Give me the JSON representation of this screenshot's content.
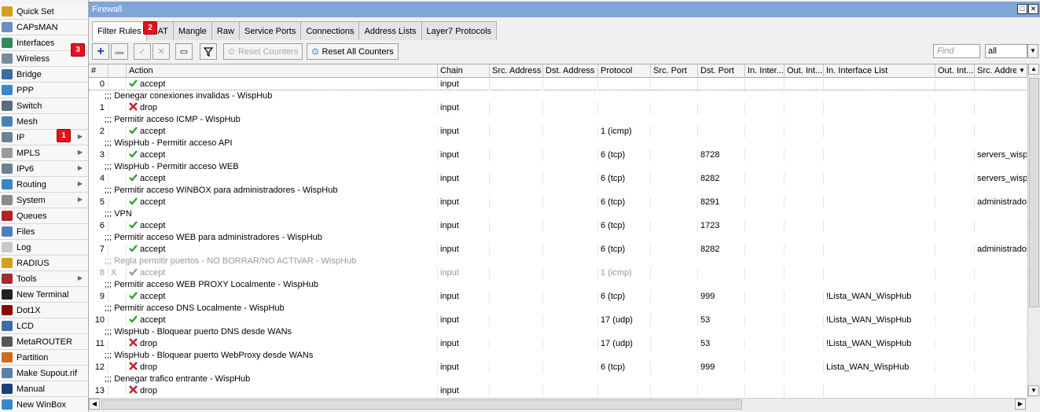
{
  "sidebar": {
    "items": [
      {
        "label": "Quick Set",
        "icon": "quick-set-icon",
        "color": "#d4a017",
        "arrow": false
      },
      {
        "label": "CAPsMAN",
        "icon": "capsman-icon",
        "color": "#6a8fbf",
        "arrow": false
      },
      {
        "label": "Interfaces",
        "icon": "interfaces-icon",
        "color": "#2e8b57",
        "arrow": false
      },
      {
        "label": "Wireless",
        "icon": "wireless-icon",
        "color": "#7a8a9a",
        "arrow": false
      },
      {
        "label": "Bridge",
        "icon": "bridge-icon",
        "color": "#3a6ea5",
        "arrow": false
      },
      {
        "label": "PPP",
        "icon": "ppp-icon",
        "color": "#3a86c8",
        "arrow": false
      },
      {
        "label": "Switch",
        "icon": "switch-icon",
        "color": "#5a6b7b",
        "arrow": false
      },
      {
        "label": "Mesh",
        "icon": "mesh-icon",
        "color": "#4682b4",
        "arrow": false
      },
      {
        "label": "IP",
        "icon": "ip-icon",
        "color": "#708090",
        "arrow": true
      },
      {
        "label": "MPLS",
        "icon": "mpls-icon",
        "color": "#999999",
        "arrow": true
      },
      {
        "label": "IPv6",
        "icon": "ipv6-icon",
        "color": "#708090",
        "arrow": true
      },
      {
        "label": "Routing",
        "icon": "routing-icon",
        "color": "#3a86c8",
        "arrow": true
      },
      {
        "label": "System",
        "icon": "system-icon",
        "color": "#8a8a8a",
        "arrow": true
      },
      {
        "label": "Queues",
        "icon": "queues-icon",
        "color": "#b22222",
        "arrow": false
      },
      {
        "label": "Files",
        "icon": "files-icon",
        "color": "#4a7fc1",
        "arrow": false
      },
      {
        "label": "Log",
        "icon": "log-icon",
        "color": "#c8c8c8",
        "arrow": false
      },
      {
        "label": "RADIUS",
        "icon": "radius-icon",
        "color": "#d4a017",
        "arrow": false
      },
      {
        "label": "Tools",
        "icon": "tools-icon",
        "color": "#a52a2a",
        "arrow": true
      },
      {
        "label": "New Terminal",
        "icon": "terminal-icon",
        "color": "#222222",
        "arrow": false
      },
      {
        "label": "Dot1X",
        "icon": "dot1x-icon",
        "color": "#8b0000",
        "arrow": false
      },
      {
        "label": "LCD",
        "icon": "lcd-icon",
        "color": "#3a6ea5",
        "arrow": false
      },
      {
        "label": "MetaROUTER",
        "icon": "metarouter-icon",
        "color": "#555555",
        "arrow": false
      },
      {
        "label": "Partition",
        "icon": "partition-icon",
        "color": "#d2691e",
        "arrow": false
      },
      {
        "label": "Make Supout.rif",
        "icon": "supout-icon",
        "color": "#5a7fa8",
        "arrow": false
      },
      {
        "label": "Manual",
        "icon": "manual-icon",
        "color": "#1e3f7a",
        "arrow": false
      },
      {
        "label": "New WinBox",
        "icon": "winbox-icon",
        "color": "#3a86c8",
        "arrow": false
      }
    ]
  },
  "markers": {
    "one": "1",
    "two": "2",
    "three": "3"
  },
  "window": {
    "title": "Firewall"
  },
  "tabs": [
    "Filter Rules",
    "NAT",
    "Mangle",
    "Raw",
    "Service Ports",
    "Connections",
    "Address Lists",
    "Layer7 Protocols"
  ],
  "toolbar": {
    "add": "+",
    "reset_counters": "Reset Counters",
    "reset_all_counters": "Reset All Counters",
    "find_placeholder": "Find",
    "filter_value": "all"
  },
  "columns": [
    "#",
    "",
    "Action",
    "Chain",
    "Src. Address",
    "Dst. Address",
    "Protocol",
    "Src. Port",
    "Dst. Port",
    "In. Inter...",
    "Out. Int...",
    "In. Interface List",
    "Out. Int...",
    "Src. Address"
  ],
  "rows": [
    {
      "type": "rule",
      "num": "0",
      "flag": "",
      "action": "accept",
      "chain": "input",
      "protocol": "",
      "dst_port": "",
      "in_list": "",
      "src_list": ""
    },
    {
      "type": "comment",
      "text": ";;; Denegar conexiones invalidas - WispHub"
    },
    {
      "type": "rule",
      "num": "1",
      "flag": "",
      "action": "drop",
      "chain": "input",
      "protocol": "",
      "dst_port": "",
      "in_list": "",
      "src_list": ""
    },
    {
      "type": "comment",
      "text": ";;; Permitir acceso ICMP - WispHub"
    },
    {
      "type": "rule",
      "num": "2",
      "flag": "",
      "action": "accept",
      "chain": "input",
      "protocol": "1 (icmp)",
      "dst_port": "",
      "in_list": "",
      "src_list": ""
    },
    {
      "type": "comment",
      "text": ";;; WispHub - Permitir acceso API"
    },
    {
      "type": "rule",
      "num": "3",
      "flag": "",
      "action": "accept",
      "chain": "input",
      "protocol": "6 (tcp)",
      "dst_port": "8728",
      "in_list": "",
      "src_list": "servers_wisph"
    },
    {
      "type": "comment",
      "text": ";;; WispHub - Permitir acceso WEB"
    },
    {
      "type": "rule",
      "num": "4",
      "flag": "",
      "action": "accept",
      "chain": "input",
      "protocol": "6 (tcp)",
      "dst_port": "8282",
      "in_list": "",
      "src_list": "servers_wisph"
    },
    {
      "type": "comment",
      "text": ";;; Permitir acceso WINBOX para administradores - WispHub"
    },
    {
      "type": "rule",
      "num": "5",
      "flag": "",
      "action": "accept",
      "chain": "input",
      "protocol": "6 (tcp)",
      "dst_port": "8291",
      "in_list": "",
      "src_list": "administrador"
    },
    {
      "type": "comment",
      "text": ";;; VPN"
    },
    {
      "type": "rule",
      "num": "6",
      "flag": "",
      "action": "accept",
      "chain": "input",
      "protocol": "6 (tcp)",
      "dst_port": "1723",
      "in_list": "",
      "src_list": ""
    },
    {
      "type": "comment",
      "text": ";;; Permitir acceso WEB para administradores - WispHub"
    },
    {
      "type": "rule",
      "num": "7",
      "flag": "",
      "action": "accept",
      "chain": "input",
      "protocol": "6 (tcp)",
      "dst_port": "8282",
      "in_list": "",
      "src_list": "administrador"
    },
    {
      "type": "comment",
      "text": ";;; Regla permitir puertos - NO BORRAR/NO ACTIVAR - WispHub",
      "disabled": true
    },
    {
      "type": "rule",
      "num": "8",
      "flag": "X",
      "action": "accept",
      "chain": "input",
      "protocol": "1 (icmp)",
      "dst_port": "",
      "in_list": "",
      "src_list": "",
      "disabled": true
    },
    {
      "type": "comment",
      "text": ";;; Permitir acceso WEB PROXY Localmente - WispHub"
    },
    {
      "type": "rule",
      "num": "9",
      "flag": "",
      "action": "accept",
      "chain": "input",
      "protocol": "6 (tcp)",
      "dst_port": "999",
      "in_list": "!Lista_WAN_WispHub",
      "src_list": ""
    },
    {
      "type": "comment",
      "text": ";;; Permitir acceso DNS Localmente - WispHub"
    },
    {
      "type": "rule",
      "num": "10",
      "flag": "",
      "action": "accept",
      "chain": "input",
      "protocol": "17 (udp)",
      "dst_port": "53",
      "in_list": "!Lista_WAN_WispHub",
      "src_list": ""
    },
    {
      "type": "comment",
      "text": ";;; WispHub - Bloquear puerto DNS desde WANs"
    },
    {
      "type": "rule",
      "num": "11",
      "flag": "",
      "action": "drop",
      "chain": "input",
      "protocol": "17 (udp)",
      "dst_port": "53",
      "in_list": "!Lista_WAN_WispHub",
      "src_list": ""
    },
    {
      "type": "comment",
      "text": ";;; WispHub - Bloquear puerto WebProxy desde WANs"
    },
    {
      "type": "rule",
      "num": "12",
      "flag": "",
      "action": "drop",
      "chain": "input",
      "protocol": "6 (tcp)",
      "dst_port": "999",
      "in_list": "Lista_WAN_WispHub",
      "src_list": ""
    },
    {
      "type": "comment",
      "text": ";;; Denegar trafico entrante - WispHub"
    },
    {
      "type": "rule",
      "num": "13",
      "flag": "",
      "action": "drop",
      "chain": "input",
      "protocol": "",
      "dst_port": "",
      "in_list": "",
      "src_list": ""
    }
  ],
  "colors": {
    "accept": "#2aa52a",
    "drop": "#c8202a",
    "title_bar": "#7fa5d9",
    "marker": "#e0141e"
  }
}
